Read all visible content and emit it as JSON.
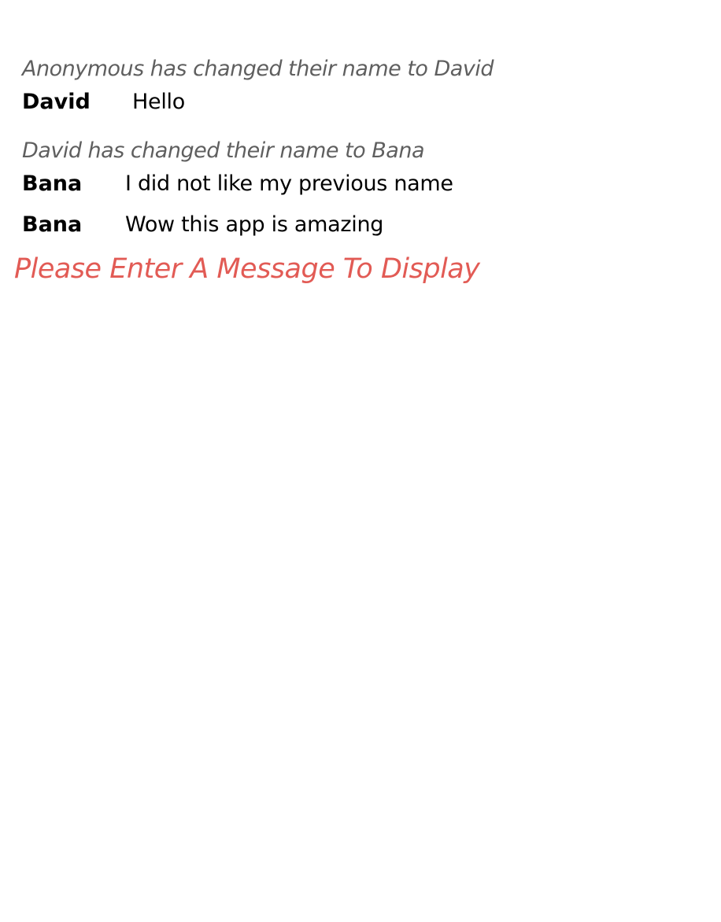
{
  "chat": {
    "events": [
      {
        "type": "system",
        "text": "Anonymous has changed their name to David"
      },
      {
        "type": "message",
        "author": "David",
        "text": "Hello"
      },
      {
        "type": "system",
        "text": "David has changed their name to Bana"
      },
      {
        "type": "message",
        "author": "Bana",
        "text": "I did not like my previous name"
      },
      {
        "type": "message",
        "author": "Bana",
        "text": "Wow this app is amazing"
      }
    ]
  },
  "error": {
    "text": "Please Enter A Message To Display",
    "color": "#e25b55"
  }
}
